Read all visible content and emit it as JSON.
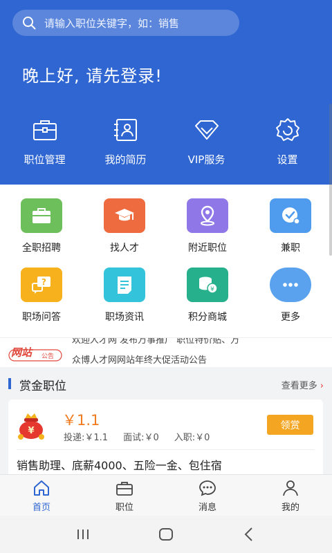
{
  "search": {
    "placeholder": "请输入职位关键字，如：销售"
  },
  "greeting": "晚上好, 请先登录!",
  "quick_actions": [
    {
      "label": "职位管理",
      "icon": "briefcase-icon"
    },
    {
      "label": "我的简历",
      "icon": "resume-icon"
    },
    {
      "label": "VIP服务",
      "icon": "diamond-icon"
    },
    {
      "label": "设置",
      "icon": "gear-icon"
    }
  ],
  "grid": [
    {
      "label": "全职招聘",
      "icon": "briefcase-icon",
      "color": "#6cbf5a"
    },
    {
      "label": "找人才",
      "icon": "graduation-cap-icon",
      "color": "#ee6a3f"
    },
    {
      "label": "附近职位",
      "icon": "location-pin-icon",
      "color": "#8f77e8"
    },
    {
      "label": "兼职",
      "icon": "clock-icon",
      "color": "#4f9cef"
    },
    {
      "label": "职场问答",
      "icon": "question-chat-icon",
      "color": "#f7b11c"
    },
    {
      "label": "职场资讯",
      "icon": "news-icon",
      "color": "#33c4dc"
    },
    {
      "label": "积分商城",
      "icon": "coins-icon",
      "color": "#27b08c"
    },
    {
      "label": "更多",
      "icon": "more-dots-icon",
      "color": "#5aa2ee"
    }
  ],
  "notice": {
    "badge": "网站",
    "badge_sub": "公告",
    "lines": [
      "欢迎人才网 发布万事推广 职位特价贴、万",
      "众博人才网网站年终大促活动公告"
    ]
  },
  "section": {
    "title": "赏金职位",
    "more": "查看更多",
    "more_icon": "chevron-right-icon"
  },
  "bounty": {
    "price": "￥1.1",
    "delivery": "投递:￥1.1",
    "interview": "面试:￥0",
    "onboard": "入职:￥0",
    "claim": "领赏",
    "title": "销售助理、底薪4000、五险一金、包住宿"
  },
  "tabs": [
    {
      "label": "首页",
      "icon": "home-icon"
    },
    {
      "label": "职位",
      "icon": "briefcase-icon"
    },
    {
      "label": "消息",
      "icon": "message-icon"
    },
    {
      "label": "我的",
      "icon": "user-icon"
    }
  ],
  "colors": {
    "primary": "#2f66d1",
    "accent": "#f07a1d",
    "claim": "#f4a622"
  }
}
